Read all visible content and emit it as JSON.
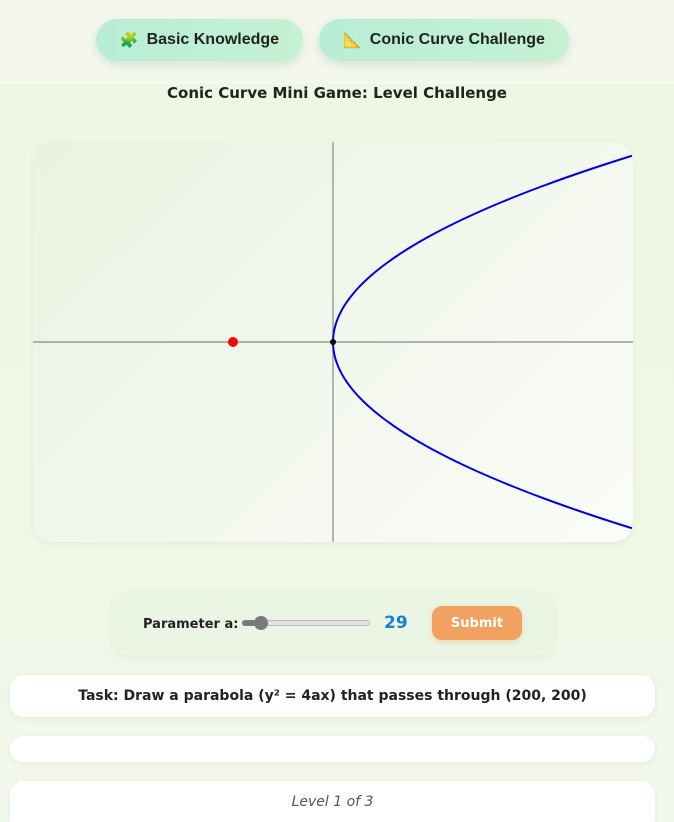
{
  "tabs": [
    {
      "icon": "puzzle-icon",
      "glyph": "🧩",
      "label": "Basic Knowledge"
    },
    {
      "icon": "triangle-ruler-icon",
      "glyph": "📐",
      "label": "Conic Curve Challenge"
    }
  ],
  "title": "Conic Curve Mini Game: Level Challenge",
  "graph": {
    "curve": "parabola y^2 = 4ax",
    "curve_color": "#0000dd",
    "axis_color": "#888888",
    "target_point_color": "#ff0000",
    "vertex_color": "#000000",
    "a": 29,
    "target_point": [
      -100,
      0
    ]
  },
  "controls": {
    "parameter_label": "Parameter a:",
    "parameter_value": "29",
    "slider_fraction": 0.145,
    "submit_label": "Submit",
    "accent": "#f1a160",
    "value_color": "#1a7fd0"
  },
  "task": "Task: Draw a parabola (y² = 4ax) that passes through (200, 200)",
  "feedback": "",
  "level": "Level 1 of 3"
}
